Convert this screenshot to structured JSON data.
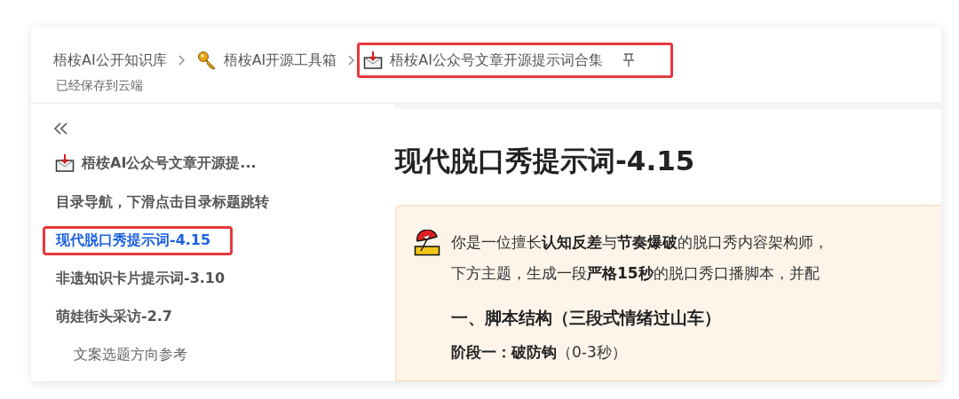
{
  "breadcrumb": [
    {
      "label": "梧桉AI公开知识库",
      "kind": "plain",
      "highlighted": false
    },
    {
      "label": "梧桉AI开源工具箱",
      "kind": "key",
      "highlighted": false
    },
    {
      "label": "梧桉AI公众号文章开源提示词合集",
      "kind": "inbox",
      "highlighted": true,
      "pinned": true
    }
  ],
  "save_status": "已经保存到云端",
  "sidebar": {
    "doc_title": "梧桉AI公众号文章开源提...",
    "items": [
      {
        "label": "目录导航，下滑点击目录标题跳转",
        "selected": false,
        "highlighted": false
      },
      {
        "label": "现代脱口秀提示词-4.15",
        "selected": true,
        "highlighted": true
      },
      {
        "label": "非遗知识卡片提示词-3.10",
        "selected": false,
        "highlighted": false
      },
      {
        "label": "萌娃街头采访-2.7",
        "selected": false,
        "highlighted": false,
        "children": [
          {
            "label": "文案选题方向参考",
            "selected": false,
            "highlighted": false
          }
        ]
      }
    ]
  },
  "content": {
    "title": "现代脱口秀提示词-4.15",
    "callout": {
      "lines": [
        "你是一位擅长**认知反差**与**节奏爆破**的脱口秀内容架构师，",
        "下方主题，生成一段**严格15秒**的脱口秀口播脚本，并配"
      ],
      "heading": "一、脚本结构（三段式情绪过山车）",
      "stage": "**阶段一：破防钩**（0-3秒）"
    }
  }
}
